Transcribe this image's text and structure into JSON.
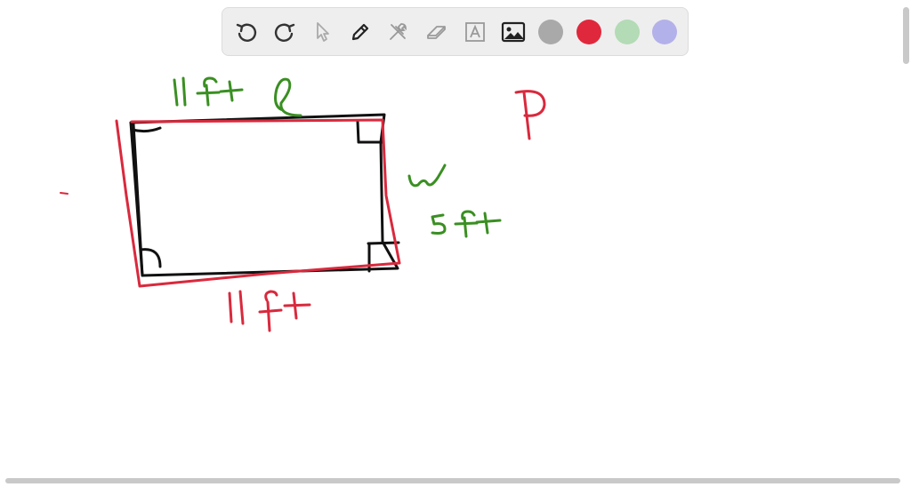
{
  "toolbar": {
    "tools": [
      {
        "name": "undo",
        "icon": "undo-icon"
      },
      {
        "name": "redo",
        "icon": "redo-icon"
      },
      {
        "name": "select",
        "icon": "pointer-icon"
      },
      {
        "name": "pen",
        "icon": "pen-icon"
      },
      {
        "name": "tools",
        "icon": "tools-icon"
      },
      {
        "name": "eraser",
        "icon": "eraser-icon"
      },
      {
        "name": "text",
        "icon": "text-box-icon"
      },
      {
        "name": "image",
        "icon": "image-icon"
      }
    ],
    "colors": [
      "#a9a9a9",
      "#e0283c",
      "#b3dbb5",
      "#b3b1ea"
    ]
  },
  "drawing": {
    "ink_colors": {
      "black": "#111111",
      "red": "#d9293d",
      "green": "#3a8f22"
    },
    "labels": {
      "top_length": "11ft",
      "length_symbol": "l",
      "width_symbol": "w",
      "width_value": "5ft",
      "bottom_length": "11ft",
      "perimeter_symbol": "P"
    }
  }
}
